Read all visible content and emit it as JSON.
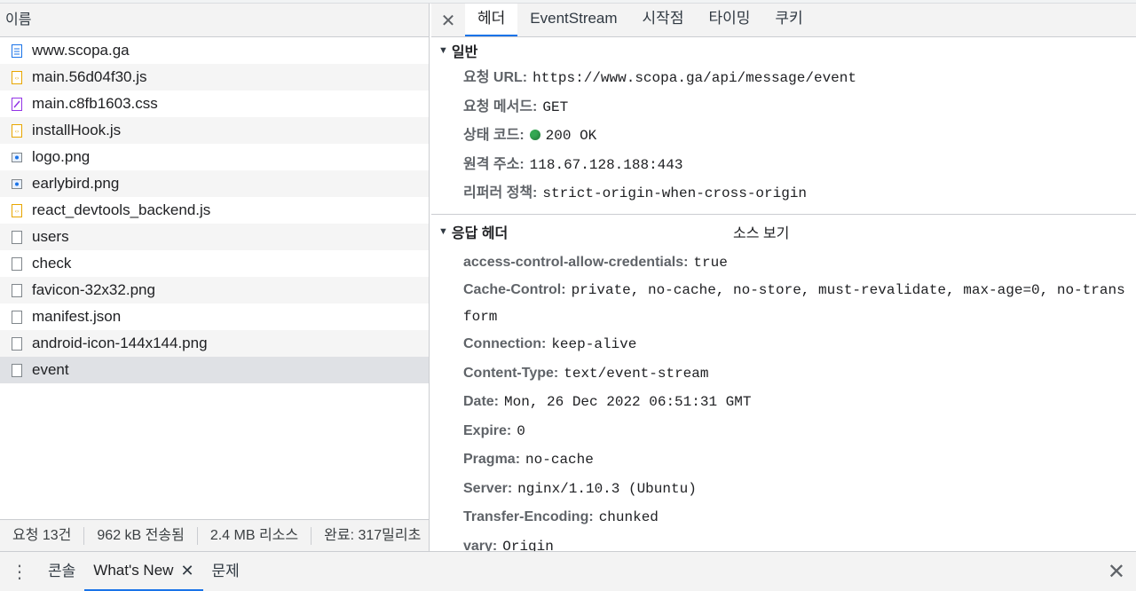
{
  "left": {
    "header": "이름",
    "requests": [
      {
        "name": "www.scopa.ga",
        "icon": "document-icon"
      },
      {
        "name": "main.56d04f30.js",
        "icon": "script-icon"
      },
      {
        "name": "main.c8fb1603.css",
        "icon": "stylesheet-icon"
      },
      {
        "name": "installHook.js",
        "icon": "script-icon"
      },
      {
        "name": "logo.png",
        "icon": "image-icon"
      },
      {
        "name": "earlybird.png",
        "icon": "image-icon"
      },
      {
        "name": "react_devtools_backend.js",
        "icon": "script-icon"
      },
      {
        "name": "users",
        "icon": "blank-file-icon"
      },
      {
        "name": "check",
        "icon": "blank-file-icon"
      },
      {
        "name": "favicon-32x32.png",
        "icon": "blank-file-icon"
      },
      {
        "name": "manifest.json",
        "icon": "blank-file-icon"
      },
      {
        "name": "android-icon-144x144.png",
        "icon": "blank-file-icon"
      },
      {
        "name": "event",
        "icon": "blank-file-icon",
        "selected": true
      }
    ],
    "status": {
      "requests": "요청 13건",
      "transferred": "962 kB 전송됨",
      "resources": "2.4 MB 리소스",
      "finish": "완료: 317밀리초"
    }
  },
  "right": {
    "tabs": [
      "헤더",
      "EventStream",
      "시작점",
      "타이밍",
      "쿠키"
    ],
    "general": {
      "title": "일반",
      "rows": [
        {
          "k": "요청 URL:",
          "v": "https://www.scopa.ga/api/message/event"
        },
        {
          "k": "요청 메서드:",
          "v": "GET"
        },
        {
          "k": "상태 코드:",
          "v": "200 OK"
        },
        {
          "k": "원격 주소:",
          "v": "118.67.128.188:443"
        },
        {
          "k": "리퍼러 정책:",
          "v": "strict-origin-when-cross-origin"
        }
      ]
    },
    "response": {
      "title": "응답 헤더",
      "view_source": "소스 보기",
      "rows": [
        {
          "k": "access-control-allow-credentials:",
          "v": "true"
        },
        {
          "k": "Cache-Control:",
          "v": "private, no-cache, no-store, must-revalidate, max-age=0, no-transform"
        },
        {
          "k": "Connection:",
          "v": "keep-alive"
        },
        {
          "k": "Content-Type:",
          "v": "text/event-stream"
        },
        {
          "k": "Date:",
          "v": "Mon, 26 Dec 2022 06:51:31 GMT"
        },
        {
          "k": "Expire:",
          "v": "0"
        },
        {
          "k": "Pragma:",
          "v": "no-cache"
        },
        {
          "k": "Server:",
          "v": "nginx/1.10.3 (Ubuntu)"
        },
        {
          "k": "Transfer-Encoding:",
          "v": "chunked"
        },
        {
          "k": "vary:",
          "v": "Origin"
        }
      ]
    }
  },
  "drawer": {
    "tabs": [
      "콘솔",
      "What's New",
      "문제"
    ],
    "active": "What's New"
  },
  "colors": {
    "accent": "#1a73e8",
    "status_ok": "#34a853"
  }
}
